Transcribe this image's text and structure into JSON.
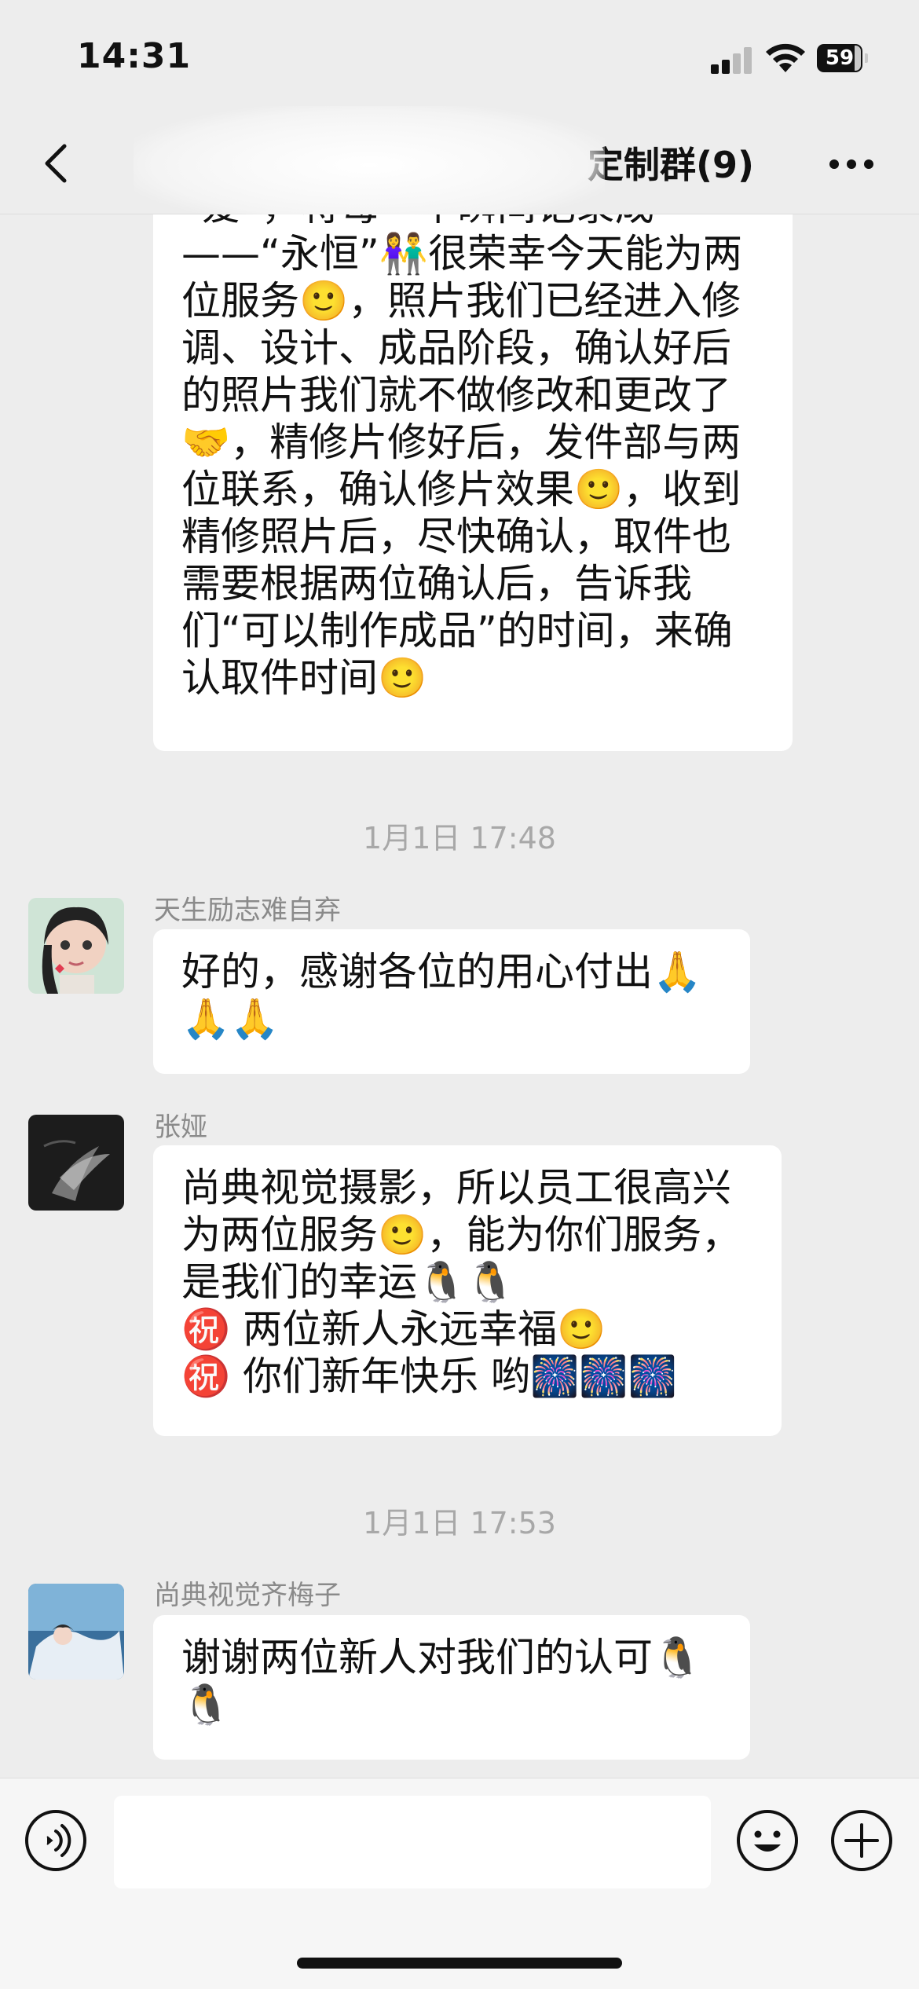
{
  "status_bar": {
    "time": "14:31",
    "battery_level": "59"
  },
  "header": {
    "title": "定制群(9)"
  },
  "messages": [
    {
      "text": "“爱”，将每一个瞬间记录成——“永恒”👫很荣幸今天能为两位服务🙂，照片我们已经进入修调、设计、成品阶段，确认好后的照片我们就不做修改和更改了🤝，精修片修好后，发件部与两位联系，确认修片效果🙂，收到精修照片后，尽快确认，取件也需要根据两位确认后，告诉我们“可以制作成品”的时间，来确认取件时间🙂"
    },
    {
      "timestamp": "1月1日 17:48"
    },
    {
      "sender": "天生励志难自弃",
      "text": "好的，感谢各位的用心付出🙏🙏🙏"
    },
    {
      "sender": "张娅",
      "text_lines": [
        "尚典视觉摄影，所以员工很高兴为两位服务🙂，能为你们服务，是我们的幸运🐧🐧",
        "㊗️ 两位新人永远幸福🙂",
        "㊗️ 你们新年快乐 哟🎆🎆🎆"
      ]
    },
    {
      "timestamp": "1月1日 17:53"
    },
    {
      "sender": "尚典视觉齐梅子",
      "text": "谢谢两位新人对我们的认可🐧🐧"
    }
  ],
  "input": {
    "placeholder": ""
  },
  "colors": {
    "background": "#ededed",
    "bubble": "#ffffff",
    "timestamp": "#a8a8a8",
    "sender": "#8a8a8a"
  },
  "icons": [
    "back-icon",
    "more-icon",
    "voice-icon",
    "emoji-icon",
    "plus-icon"
  ]
}
